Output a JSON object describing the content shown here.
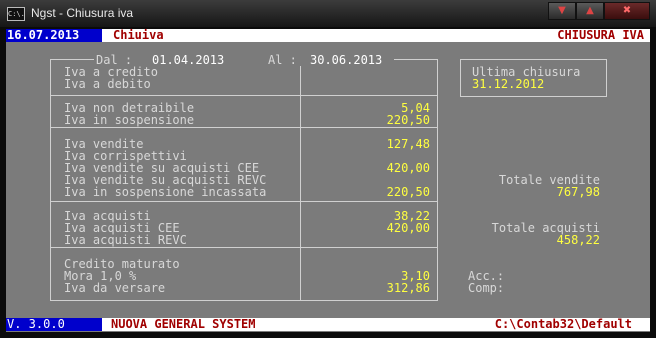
{
  "window": {
    "title": "Ngst - Chiusura iva",
    "icon": "C:\\."
  },
  "top_bar": {
    "date": "16.07.2013",
    "module": "Chiuiva",
    "screen": "CHIUSURA IVA"
  },
  "period": {
    "dal_label": "Dal :",
    "dal": "01.04.2013",
    "al_label": "Al :",
    "al": "30.06.2013"
  },
  "rows": {
    "iva_credito": "Iva a credito",
    "iva_debito": "Iva a debito",
    "iva_non_detraibile": {
      "label": "Iva non detraibile",
      "value": "5,04"
    },
    "iva_sospensione": {
      "label": "Iva in sospensione",
      "value": "220,50"
    },
    "iva_vendite": {
      "label": "Iva vendite",
      "value": "127,48"
    },
    "iva_corrispettivi": {
      "label": "Iva corrispettivi",
      "value": ""
    },
    "iva_vendite_cee": {
      "label": "Iva vendite su acquisti CEE",
      "value": "420,00"
    },
    "iva_vendite_revc": {
      "label": "Iva vendite su acquisti REVC",
      "value": ""
    },
    "iva_sospensione_incassata": {
      "label": "Iva in sospensione incassata",
      "value": "220,50"
    },
    "iva_acquisti": {
      "label": "Iva acquisti",
      "value": "38,22"
    },
    "iva_acquisti_cee": {
      "label": "Iva acquisti CEE",
      "value": "420,00"
    },
    "iva_acquisti_revc": {
      "label": "Iva acquisti REVC",
      "value": ""
    },
    "credito_maturato": {
      "label": "Credito maturato",
      "value": ""
    },
    "mora": {
      "label": "Mora 1,0 %",
      "value": "3,10"
    },
    "iva_da_versare": {
      "label": "Iva da versare",
      "value": "312,86"
    }
  },
  "right": {
    "ultima_chiusura_label": "Ultima chiusura",
    "ultima_chiusura": "31.12.2012",
    "totale_vendite_label": "Totale vendite",
    "totale_vendite": "767,98",
    "totale_acquisti_label": "Totale acquisti",
    "totale_acquisti": "458,22",
    "acc_label": "Acc.:",
    "comp_label": "Comp:"
  },
  "bottom_bar": {
    "version": "V. 3.0.0",
    "product": "NUOVA GENERAL SYSTEM",
    "path": "C:\\Contab32\\Default"
  },
  "colors": {
    "background": "#7b7b7b",
    "value": "#ffff40",
    "accent_blue": "#0000cc",
    "accent_red": "#a00000"
  }
}
